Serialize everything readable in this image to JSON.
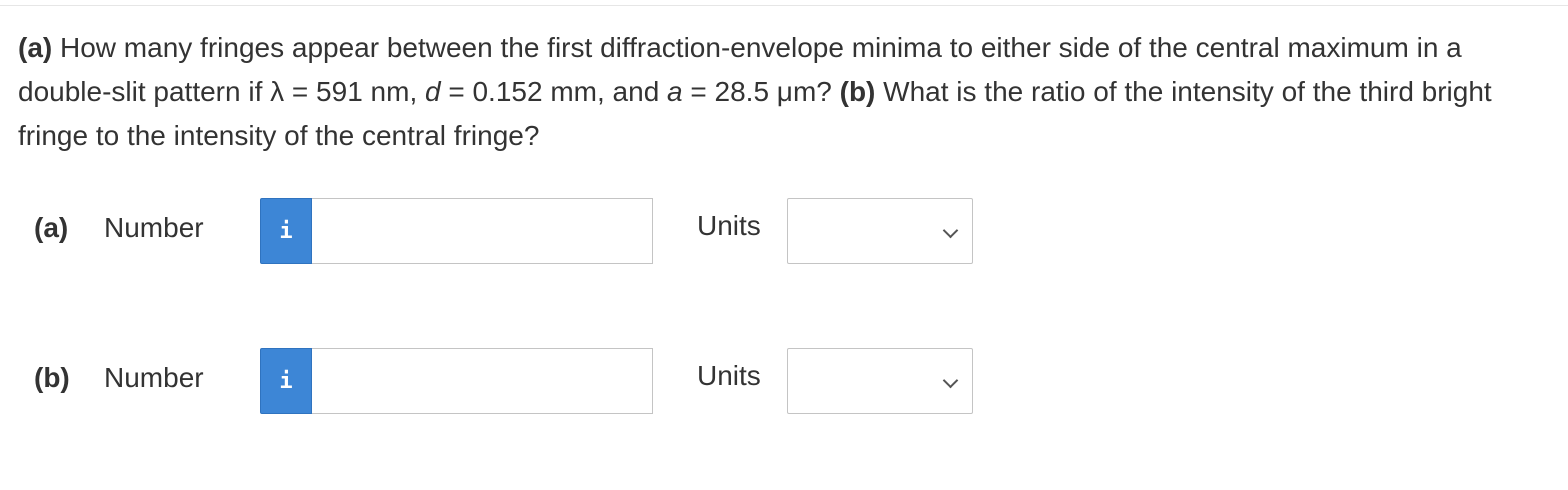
{
  "question": {
    "part_a_tag": "(a)",
    "text_1": " How many fringes appear between the first diffraction-envelope minima to either side of the central maximum in a double-slit pattern if λ = 591 nm, ",
    "var_d": "d",
    "text_2": " = 0.152 mm, and ",
    "var_a": "a",
    "text_3": " = 28.5 μm? ",
    "part_b_tag": "(b)",
    "text_4": " What is the ratio of the intensity of the third bright fringe to the intensity of the central fringe?"
  },
  "answers": [
    {
      "part_label": "(a)",
      "number_label": "Number",
      "info_glyph": "i",
      "number_value": "",
      "units_label": "Units",
      "units_selected": ""
    },
    {
      "part_label": "(b)",
      "number_label": "Number",
      "info_glyph": "i",
      "number_value": "",
      "units_label": "Units",
      "units_selected": ""
    }
  ],
  "colors": {
    "info_button": "#3d86d6",
    "text": "#333333",
    "border": "#c4c4c4"
  },
  "icons": {
    "info": "info-icon",
    "dropdown": "chevron-down-icon"
  }
}
